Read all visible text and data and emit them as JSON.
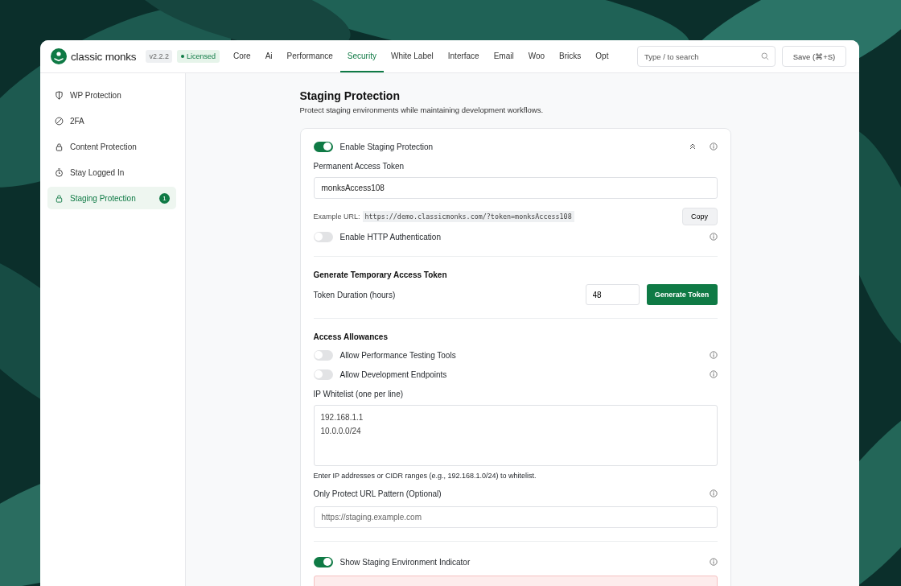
{
  "header": {
    "logo": "classic monks",
    "version": "v2.2.2",
    "license": "Licensed"
  },
  "tabs": [
    {
      "label": "Core",
      "selected": false
    },
    {
      "label": "Ai",
      "selected": false
    },
    {
      "label": "Performance",
      "selected": false
    },
    {
      "label": "Security",
      "selected": true
    },
    {
      "label": "White Label",
      "selected": false
    },
    {
      "label": "Interface",
      "selected": false
    },
    {
      "label": "Email",
      "selected": false
    },
    {
      "label": "Woo",
      "selected": false
    },
    {
      "label": "Bricks",
      "selected": false
    },
    {
      "label": "Opt",
      "selected": false
    }
  ],
  "search": {
    "placeholder": "Type / to search"
  },
  "save_button": "Save (⌘+S)",
  "sidebar": {
    "items": [
      {
        "label": "WP Protection",
        "selected": false
      },
      {
        "label": "2FA",
        "selected": false
      },
      {
        "label": "Content Protection",
        "selected": false
      },
      {
        "label": "Stay Logged In",
        "selected": false
      },
      {
        "label": "Staging Protection",
        "selected": true,
        "badge": "1"
      }
    ]
  },
  "page": {
    "title": "Staging Protection",
    "subtitle": "Protect staging environments while maintaining development workflows."
  },
  "settings": {
    "enable": {
      "label": "Enable Staging Protection",
      "on": true
    },
    "token_label": "Permanent Access Token",
    "token_value": "monksAccess108",
    "example_label": "Example URL:",
    "example_url": "https://demo.classicmonks.com/?token=monksAccess108",
    "copy_button": "Copy",
    "http_auth": {
      "label": "Enable HTTP Authentication",
      "on": false
    },
    "temp_title": "Generate Temporary Access Token",
    "duration_label": "Token Duration (hours)",
    "duration_value": "48",
    "generate_button": "Generate Token",
    "allow_title": "Access Allowances",
    "allowances": [
      {
        "label": "Allow Performance Testing Tools",
        "on": false
      },
      {
        "label": "Allow Development Endpoints",
        "on": false
      }
    ],
    "whitelist_label": "IP Whitelist (one per line)",
    "whitelist": [
      "192.168.1.1",
      "10.0.0.0/24"
    ],
    "whitelist_help": "Enter IP addresses or CIDR ranges (e.g., 192.168.1.0/24) to whitelist.",
    "pattern_label": "Only Protect URL Pattern (Optional)",
    "pattern_placeholder": "https://staging.example.com",
    "indicator": {
      "label": "Show Staging Environment Indicator",
      "on": true
    }
  }
}
